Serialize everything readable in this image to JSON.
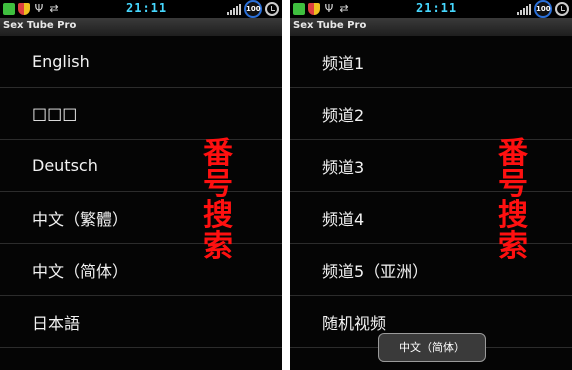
{
  "status_bar": {
    "time": "21:11",
    "battery": "100"
  },
  "app": {
    "title": "Sex Tube Pro"
  },
  "left_screen": {
    "languages": [
      {
        "label": "English"
      },
      {
        "label": "□□□"
      },
      {
        "label": "Deutsch"
      },
      {
        "label": "中文（繁體）"
      },
      {
        "label": "中文（简体）"
      },
      {
        "label": "日本語"
      }
    ],
    "overlay": [
      "番",
      "号",
      "搜",
      "索"
    ]
  },
  "right_screen": {
    "channels": [
      {
        "label": "频道1"
      },
      {
        "label": "频道2"
      },
      {
        "label": "频道3"
      },
      {
        "label": "频道4"
      },
      {
        "label": "频道5（亚洲）"
      },
      {
        "label": "随机视频"
      }
    ],
    "overlay": [
      "番",
      "号",
      "搜",
      "索"
    ],
    "toast": "中文（简体）"
  },
  "colors": {
    "overlay_text": "#ff1010",
    "clock": "#46d8ff",
    "background": "#050505"
  }
}
